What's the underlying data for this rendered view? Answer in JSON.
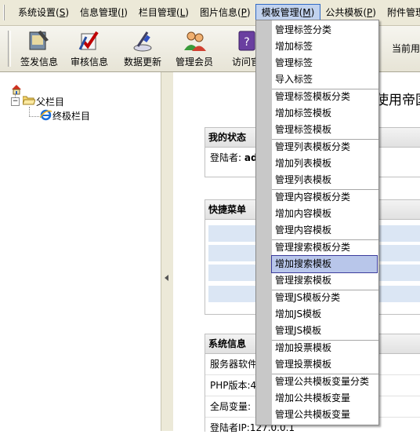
{
  "menubar": {
    "items": [
      {
        "label": "系统设置(",
        "key": "S",
        "end": ")"
      },
      {
        "label": "信息管理(",
        "key": "I",
        "end": ")"
      },
      {
        "label": "栏目管理(",
        "key": "L",
        "end": ")"
      },
      {
        "label": "图片信息(",
        "key": "P",
        "end": ")"
      },
      {
        "label": "模板管理(",
        "key": "M",
        "end": ")"
      },
      {
        "label": "公共模板(",
        "key": "P",
        "end": ")"
      },
      {
        "label": "附件管理",
        "key": "",
        "end": ""
      }
    ]
  },
  "toolbar": {
    "buttons": [
      {
        "label": "签发信息",
        "icon": "sign-icon"
      },
      {
        "label": "审核信息",
        "icon": "audit-icon"
      },
      {
        "label": "数据更新",
        "icon": "update-icon"
      },
      {
        "label": "管理会员",
        "icon": "members-icon"
      },
      {
        "label": "访问官",
        "icon": "visit-icon"
      }
    ],
    "current_label": "当前用"
  },
  "tree": {
    "parent": "父栏目",
    "child": "终极栏目"
  },
  "main": {
    "title": "使用帝国",
    "status": {
      "heading": "我的状态",
      "login_label": "登陆者:",
      "login_value": "ad"
    },
    "quick": {
      "heading": "快捷菜单"
    },
    "sysinfo": {
      "heading": "系统信息",
      "rows": [
        "服务器软件",
        "PHP版本:4",
        "全局变量:",
        "登陆者IP:127.0.0.1"
      ]
    }
  },
  "dropdown": {
    "items": [
      "管理标签分类",
      "增加标签",
      "管理标签",
      "导入标签",
      "管理标签模板分类",
      "增加标签模板",
      "管理标签模板",
      "管理列表模板分类",
      "增加列表模板",
      "管理列表模板",
      "管理内容模板分类",
      "增加内容模板",
      "管理内容模板",
      "管理搜索模板分类",
      "增加搜索模板",
      "管理搜索模板",
      "管理JS模板分类",
      "增加JS模板",
      "管理JS模板",
      "增加投票模板",
      "管理投票模板",
      "管理公共模板变量分类",
      "增加公共模板变量",
      "管理公共模板变量"
    ],
    "highlighted": "增加搜索模板"
  },
  "colors": {
    "accent": "#316ac5",
    "highlight": "#b8c6ea",
    "quick_row": "#dbe6f4"
  }
}
